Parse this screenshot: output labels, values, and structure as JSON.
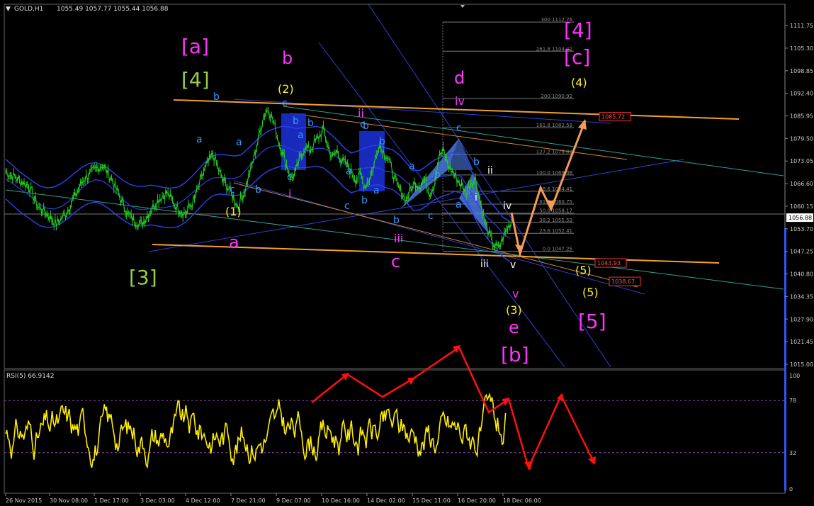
{
  "window": {
    "symbol_label": "GOLD,H1",
    "ohlc": "1055.49 1057.77 1055.44 1056.88",
    "indicator_label": "RSI(5) 66.9142"
  },
  "colors": {
    "background": "#000000",
    "price": "#22cc22",
    "bands": "#2a3fe0",
    "orange": "#f0a030",
    "rsi": "#ffee00",
    "arrow_red": "#ff1010",
    "arrow_orange": "#f39c55",
    "magenta": "#ff33ff",
    "olive": "#99cc44",
    "yellow": "#ffee22",
    "cyan": "#3399ff",
    "fib": "#777777"
  },
  "chart_data": [
    {
      "type": "line",
      "name": "price",
      "ylim": [
        1015.0,
        1115.0
      ],
      "current_price": "1056.88",
      "price_axis_labels": [
        "1111.75",
        "1105.30",
        "1098.85",
        "1092.40",
        "1085.95",
        "1079.50",
        "1073.05",
        "1066.60",
        "1060.15",
        "1053.70",
        "1047.25",
        "1040.80",
        "1034.35",
        "1027.90",
        "1021.45",
        "1015.00"
      ],
      "time_labels": [
        "26 Nov 2015",
        "30 Nov 08:00",
        "1 Dec 17:00",
        "3 Dec 03:00",
        "4 Dec 12:00",
        "7 Dec 21:00",
        "9 Dec 07:00",
        "10 Dec 16:00",
        "14 Dec 02:00",
        "15 Dec 11:00",
        "16 Dec 20:00",
        "18 Dec 06:00"
      ],
      "series_points": [
        [
          0,
          1070
        ],
        [
          5,
          1068
        ],
        [
          10,
          1066
        ],
        [
          14,
          1060
        ],
        [
          18,
          1058
        ],
        [
          22,
          1055
        ],
        [
          26,
          1058
        ],
        [
          30,
          1063
        ],
        [
          34,
          1068
        ],
        [
          38,
          1070
        ],
        [
          42,
          1072
        ],
        [
          46,
          1068
        ],
        [
          50,
          1062
        ],
        [
          53,
          1058
        ],
        [
          56,
          1056
        ],
        [
          59,
          1055
        ],
        [
          62,
          1058
        ],
        [
          66,
          1062
        ],
        [
          70,
          1064
        ],
        [
          74,
          1060
        ],
        [
          78,
          1058
        ],
        [
          82,
          1062
        ],
        [
          86,
          1070
        ],
        [
          90,
          1075
        ],
        [
          94,
          1068
        ],
        [
          98,
          1064
        ],
        [
          101,
          1060
        ],
        [
          104,
          1065
        ],
        [
          107,
          1072
        ],
        [
          110,
          1080
        ],
        [
          112,
          1086
        ],
        [
          114,
          1088
        ],
        [
          116,
          1085
        ],
        [
          118,
          1080
        ],
        [
          120,
          1076
        ],
        [
          122,
          1072
        ],
        [
          124,
          1068
        ],
        [
          126,
          1070
        ],
        [
          128,
          1074
        ],
        [
          130,
          1077
        ],
        [
          132,
          1076
        ],
        [
          134,
          1078
        ],
        [
          136,
          1080
        ],
        [
          138,
          1082
        ],
        [
          140,
          1077
        ],
        [
          142,
          1074
        ],
        [
          144,
          1076
        ],
        [
          146,
          1073
        ],
        [
          148,
          1072
        ],
        [
          150,
          1070
        ],
        [
          152,
          1068
        ],
        [
          154,
          1069
        ],
        [
          156,
          1066
        ],
        [
          158,
          1068
        ],
        [
          160,
          1072
        ],
        [
          162,
          1078
        ],
        [
          164,
          1076
        ],
        [
          166,
          1074
        ],
        [
          168,
          1070
        ],
        [
          170,
          1066
        ],
        [
          172,
          1064
        ],
        [
          174,
          1062
        ],
        [
          176,
          1065
        ],
        [
          178,
          1067
        ],
        [
          180,
          1066
        ],
        [
          182,
          1068
        ],
        [
          184,
          1064
        ],
        [
          186,
          1066
        ],
        [
          188,
          1074
        ],
        [
          190,
          1076
        ],
        [
          192,
          1072
        ],
        [
          194,
          1070
        ],
        [
          196,
          1068
        ],
        [
          198,
          1066
        ],
        [
          200,
          1064
        ],
        [
          202,
          1067
        ],
        [
          204,
          1068
        ],
        [
          206,
          1062
        ],
        [
          208,
          1056
        ],
        [
          210,
          1052
        ],
        [
          212,
          1049
        ],
        [
          214,
          1048
        ],
        [
          216,
          1051
        ],
        [
          218,
          1054
        ],
        [
          220,
          1056
        ]
      ],
      "fib_levels": [
        {
          "label": "300 1112.76",
          "value": 1112.76
        },
        {
          "label": "261.8 1104.42",
          "value": 1104.42
        },
        {
          "label": "200 1090.92",
          "value": 1090.92
        },
        {
          "label": "161.8 1082.58",
          "value": 1082.58
        },
        {
          "label": "127.2 1075.03",
          "value": 1075.03
        },
        {
          "label": "100.0 1069.08",
          "value": 1069.08
        },
        {
          "label": "78.6 1064.41",
          "value": 1064.41
        },
        {
          "label": "61.8 1060.75",
          "value": 1060.75
        },
        {
          "label": "50.0 1058.17",
          "value": 1058.17
        },
        {
          "label": "38.2 1055.53",
          "value": 1055.53
        },
        {
          "label": "23.6 1052.41",
          "value": 1052.41
        },
        {
          "label": "0.0 1047.25",
          "value": 1047.25
        }
      ],
      "price_tags": [
        {
          "label": "1085.72",
          "value": 1085.72
        },
        {
          "label": "1043.93",
          "value": 1043.93
        },
        {
          "label": "1038.67",
          "value": 1038.67
        }
      ]
    },
    {
      "type": "line",
      "name": "RSI(5)",
      "ylim": [
        0,
        100
      ],
      "levels": [
        78,
        32
      ],
      "axis_labels": [
        "100",
        "78",
        "32",
        "0"
      ],
      "value": 66.9142
    }
  ],
  "wave_labels": [
    {
      "text": "[a]",
      "color": "magenta",
      "size": "xl"
    },
    {
      "text": "[4]",
      "color": "olive",
      "size": "xl"
    },
    {
      "text": "[3]",
      "color": "olive",
      "size": "xl"
    },
    {
      "text": "[4]",
      "color": "magenta",
      "size": "xl"
    },
    {
      "text": "[c]",
      "color": "magenta",
      "size": "xl"
    },
    {
      "text": "[5]",
      "color": "magenta",
      "size": "xl"
    },
    {
      "text": "[b]",
      "color": "magenta",
      "size": "xl"
    },
    {
      "text": "b",
      "color": "magenta",
      "size": "l"
    },
    {
      "text": "a",
      "color": "magenta",
      "size": "l"
    },
    {
      "text": "c",
      "color": "magenta",
      "size": "l"
    },
    {
      "text": "d",
      "color": "magenta",
      "size": "l"
    },
    {
      "text": "e",
      "color": "magenta",
      "size": "l"
    },
    {
      "text": "iv",
      "color": "magenta",
      "size": "m"
    },
    {
      "text": "ii",
      "color": "magenta",
      "size": "m"
    },
    {
      "text": "i",
      "color": "magenta",
      "size": "m"
    },
    {
      "text": "iii",
      "color": "magenta",
      "size": "m"
    },
    {
      "text": "v",
      "color": "magenta",
      "size": "m"
    },
    {
      "text": "(2)",
      "color": "yellow",
      "size": "m"
    },
    {
      "text": "(1)",
      "color": "yellow",
      "size": "m"
    },
    {
      "text": "(4)",
      "color": "yellow",
      "size": "m"
    },
    {
      "text": "(3)",
      "color": "yellow",
      "size": "m"
    },
    {
      "text": "(5)",
      "color": "yellow",
      "size": "m"
    },
    {
      "text": "(5)",
      "color": "yellow",
      "size": "m"
    },
    {
      "text": "b",
      "color": "cyan",
      "size": "s"
    },
    {
      "text": "a",
      "color": "cyan",
      "size": "s"
    },
    {
      "text": "c",
      "color": "cyan",
      "size": "s"
    },
    {
      "text": "b",
      "color": "cyan",
      "size": "s"
    },
    {
      "text": "a",
      "color": "cyan",
      "size": "s"
    },
    {
      "text": "c",
      "color": "cyan",
      "size": "s"
    },
    {
      "text": "b",
      "color": "cyan",
      "size": "s"
    },
    {
      "text": "a",
      "color": "cyan",
      "size": "s"
    },
    {
      "text": "b",
      "color": "cyan",
      "size": "s"
    },
    {
      "text": "c",
      "color": "cyan",
      "size": "s"
    },
    {
      "text": "b",
      "color": "cyan",
      "size": "s"
    },
    {
      "text": "a",
      "color": "cyan",
      "size": "s"
    },
    {
      "text": "c",
      "color": "cyan",
      "size": "s"
    },
    {
      "text": "b",
      "color": "cyan",
      "size": "s"
    },
    {
      "text": "a",
      "color": "cyan",
      "size": "s"
    },
    {
      "text": "b",
      "color": "cyan",
      "size": "s"
    },
    {
      "text": "c",
      "color": "cyan",
      "size": "s"
    },
    {
      "text": "b",
      "color": "cyan",
      "size": "s"
    },
    {
      "text": "c",
      "color": "cyan",
      "size": "s"
    },
    {
      "text": "a",
      "color": "cyan",
      "size": "s"
    },
    {
      "text": "b",
      "color": "cyan",
      "size": "s"
    },
    {
      "text": "a",
      "color": "cyan",
      "size": "s"
    },
    {
      "text": "b",
      "color": "cyan",
      "size": "s"
    },
    {
      "text": "c",
      "color": "cyan",
      "size": "s"
    },
    {
      "text": "ii",
      "color": "white",
      "size": "s"
    },
    {
      "text": "i",
      "color": "white",
      "size": "s"
    },
    {
      "text": "iv",
      "color": "white",
      "size": "s"
    },
    {
      "text": "iii",
      "color": "white",
      "size": "s"
    },
    {
      "text": "v",
      "color": "white",
      "size": "s"
    }
  ]
}
